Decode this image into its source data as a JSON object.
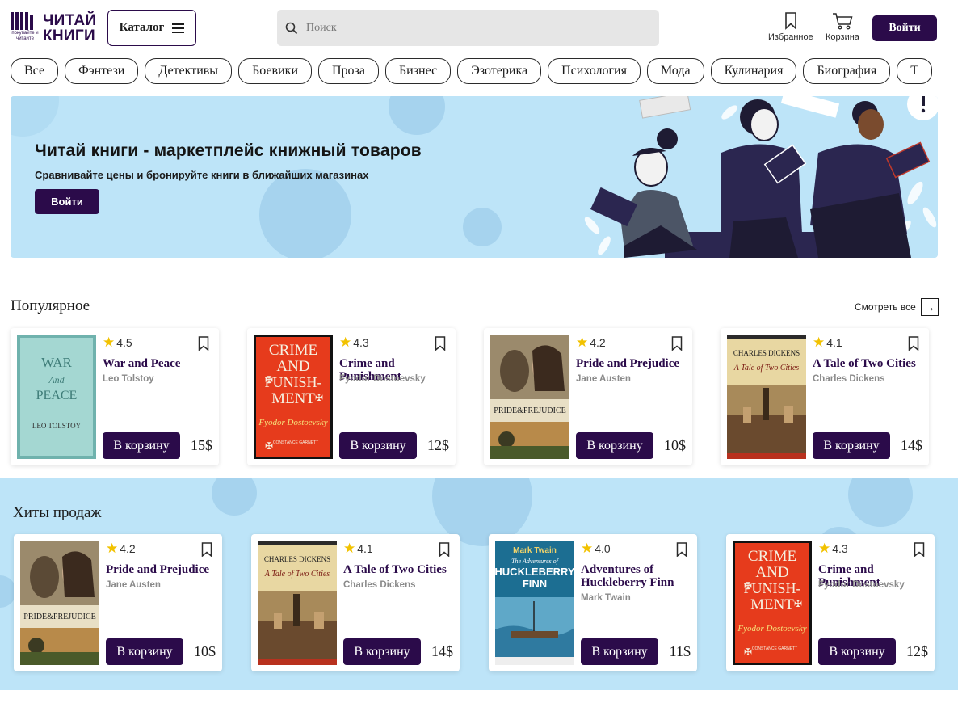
{
  "header": {
    "logo_line1": "ЧИТАЙ",
    "logo_line2": "КНИГИ",
    "logo_tag": "покупайте и читайте",
    "catalog_label": "Каталог",
    "search_placeholder": "Поиск",
    "favorites_label": "Избранное",
    "cart_label": "Корзина",
    "login_label": "Войти"
  },
  "categories": [
    "Все",
    "Фэнтези",
    "Детективы",
    "Боевики",
    "Проза",
    "Бизнес",
    "Эзотерика",
    "Психология",
    "Мода",
    "Кулинария",
    "Биография",
    "Т"
  ],
  "banner": {
    "title": "Читай книги - маркетплейс книжный товаров",
    "subtitle": "Сравнивайте цены и бронируйте книги в ближайших магазинах",
    "button_label": "Войти"
  },
  "popular": {
    "title": "Популярное",
    "see_all": "Смотреть все",
    "books": [
      {
        "rating": "4.5",
        "title": "War and Peace",
        "author": "Leo Tolstoy",
        "price": "15$",
        "cart": "В корзину",
        "cover": "war-and-peace"
      },
      {
        "rating": "4.3",
        "title": "Crime and Punishment",
        "author": "Fyodor Dostoevsky",
        "price": "12$",
        "cart": "В корзину",
        "cover": "crime-and-punishment"
      },
      {
        "rating": "4.2",
        "title": "Pride and Prejudice",
        "author": "Jane Austen",
        "price": "10$",
        "cart": "В корзину",
        "cover": "pride-and-prejudice"
      },
      {
        "rating": "4.1",
        "title": "A Tale of Two Cities",
        "author": "Charles Dickens",
        "price": "14$",
        "cart": "В корзину",
        "cover": "tale-of-two-cities"
      }
    ]
  },
  "hits": {
    "title": "Хиты продаж",
    "books": [
      {
        "rating": "4.2",
        "title": "Pride and Prejudice",
        "author": "Jane Austen",
        "price": "10$",
        "cart": "В корзину",
        "cover": "pride-and-prejudice"
      },
      {
        "rating": "4.1",
        "title": "A Tale of Two Cities",
        "author": "Charles Dickens",
        "price": "14$",
        "cart": "В корзину",
        "cover": "tale-of-two-cities"
      },
      {
        "rating": "4.0",
        "title": "Adventures of Huckleberry Finn",
        "author": "Mark Twain",
        "price": "11$",
        "cart": "В корзину",
        "cover": "huckleberry-finn"
      },
      {
        "rating": "4.3",
        "title": "Crime and Punishment",
        "author": "Fyodor Dostoevsky",
        "price": "12$",
        "cart": "В корзину",
        "cover": "crime-and-punishment"
      }
    ]
  },
  "covers": {
    "war-and-peace": {
      "l1": "WAR",
      "l2": "And",
      "l3": "PEACE",
      "l4": "LEO TOLSTOY"
    },
    "crime-and-punishment": {
      "l1": "CRIME",
      "l2": "AND",
      "l3": "PUNISH-",
      "l4": "MENT",
      "l5": "Fyodor Dostoevsky",
      "l6": "CONSTANCE GARNETT"
    },
    "pride-and-prejudice": {
      "l1": "PRIDE&PREJUDICE"
    },
    "tale-of-two-cities": {
      "l1": "CHARLES DICKENS",
      "l2": "A Tale of Two Cities"
    },
    "huckleberry-finn": {
      "l1": "Mark Twain",
      "l2": "The Adventures of",
      "l3": "HUCKLEBERRY",
      "l4": "FINN"
    }
  },
  "colors": {
    "brand": "#2b0b4a",
    "banner_bg": "#bde4f8",
    "star": "#f2c200"
  }
}
